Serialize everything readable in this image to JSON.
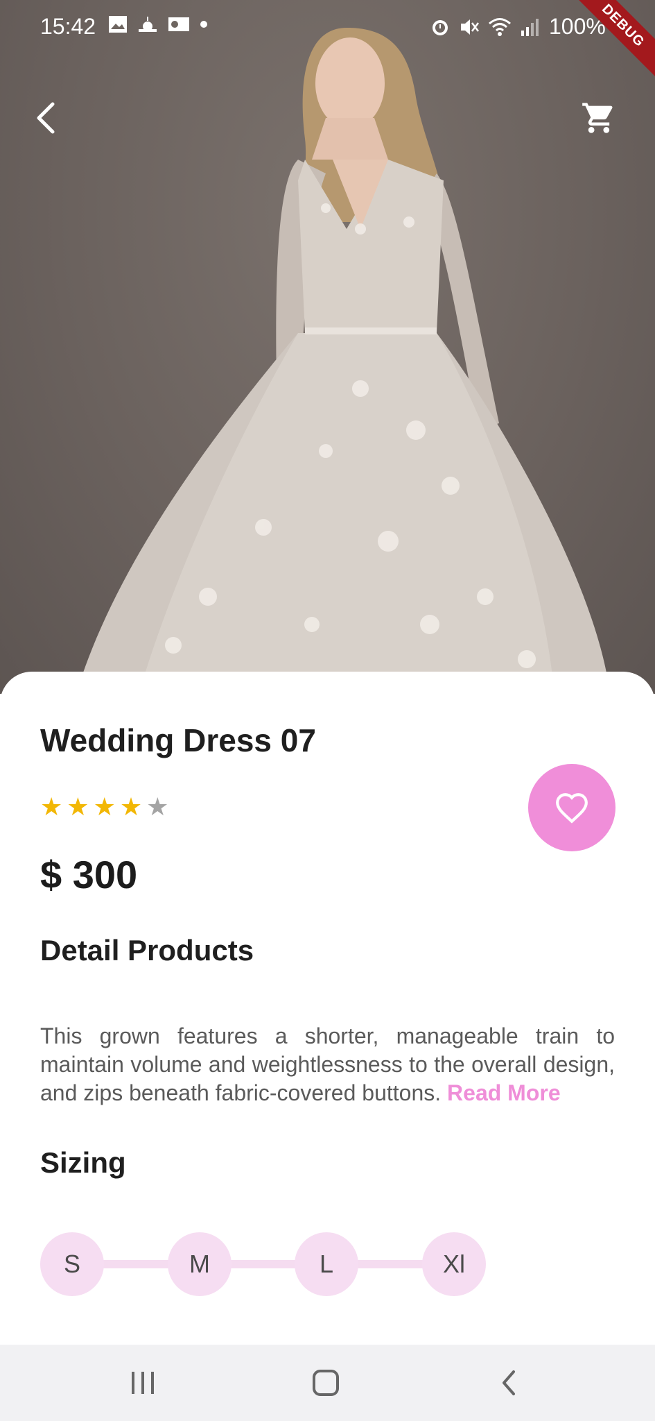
{
  "status_bar": {
    "time": "15:42",
    "battery": "100%",
    "left_icons": [
      "gallery-icon",
      "sunrise-icon",
      "outlook-icon",
      "dot-icon"
    ],
    "right_icons": [
      "alarm-icon",
      "mute-icon",
      "wifi-icon",
      "signal-icon"
    ]
  },
  "debug_banner": "DEBUG",
  "product": {
    "name": "Wedding Dress 07",
    "rating": 4,
    "rating_max": 5,
    "price": "$ 300",
    "detail_heading": "Detail Products",
    "description": "This grown features a shorter, manageable train to maintain volume and weightlessness to the overall design, and zips beneath fabric-covered buttons.",
    "read_more": "Read More",
    "sizing_heading": "Sizing",
    "sizes": [
      "S",
      "M",
      "L",
      "Xl"
    ]
  },
  "colors": {
    "accent": "#f08ed9",
    "size_chip": "#f6ddf2",
    "star": "#f2b705"
  },
  "navbar": {
    "icons": [
      "recents-icon",
      "home-icon",
      "back-icon"
    ]
  }
}
